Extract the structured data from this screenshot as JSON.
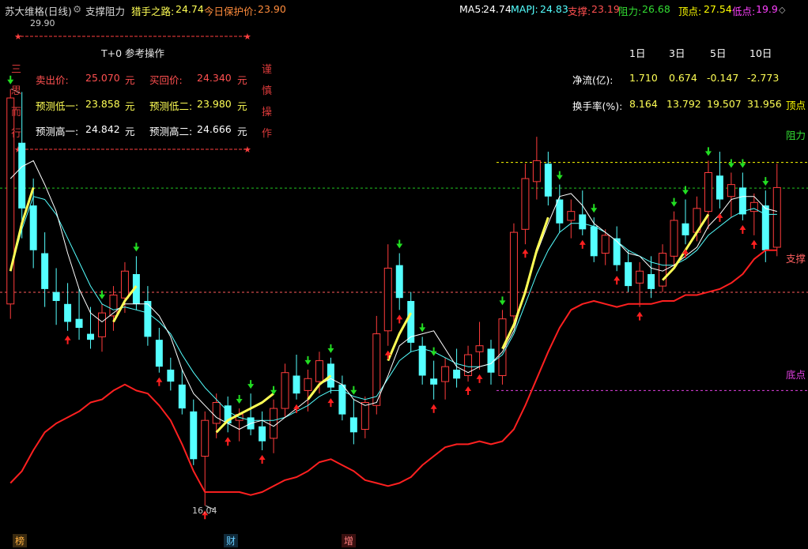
{
  "header": {
    "stock_name": "苏大维格(日线)",
    "indicator_name": "支撑阻力",
    "hunter_label": "猎手之路:",
    "hunter_value": "24.74",
    "protect_label": "今日保护价:",
    "protect_value": "23.90",
    "ma5_label": "MA5:",
    "ma5_value": "24.74",
    "mapj_label": "MAPJ:",
    "mapj_value": "24.83",
    "support_label": "支撑:",
    "support_value": "23.19",
    "resist_label": "阻力:",
    "resist_value": "26.68",
    "top_label": "顶点:",
    "top_value": "27.54",
    "bottom_label": "低点:",
    "bottom_value": "19.9"
  },
  "t0_panel": {
    "title": "T+0 参考操作",
    "left_vertical": [
      "三",
      "思",
      "而",
      "行"
    ],
    "right_vertical": [
      "谨",
      "慎",
      "操",
      "作"
    ],
    "rows": [
      {
        "l1": "卖出价:",
        "v1": "25.070",
        "u1": "元",
        "l2": "买回价:",
        "v2": "24.340",
        "u2": "元"
      },
      {
        "l1": "预测低一:",
        "v1": "23.858",
        "u1": "元",
        "l2": "预测低二:",
        "v2": "23.980",
        "u2": "元"
      },
      {
        "l1": "预测高一:",
        "v1": "24.842",
        "u1": "元",
        "l2": "预测高二:",
        "v2": "24.666",
        "u2": "元"
      }
    ]
  },
  "stats_table": {
    "periods": [
      "1日",
      "3日",
      "5日",
      "10日"
    ],
    "rows": [
      {
        "label": "净流(亿):",
        "values": [
          "1.710",
          "0.674",
          "-0.147",
          "-2.773"
        ]
      },
      {
        "label": "换手率(%):",
        "values": [
          "8.164",
          "13.792",
          "19.507",
          "31.956"
        ]
      }
    ]
  },
  "level_labels": {
    "resist": "阻力",
    "top": "顶点",
    "support": "支撑",
    "bottom": "底点"
  },
  "price_marks": {
    "high": "29.90",
    "low": "16.04"
  },
  "bottom_badges": [
    "榜",
    "财",
    "增"
  ],
  "colors": {
    "up": "#ff3c3c",
    "down": "#54ffff",
    "fast_line": "#ffff55",
    "support_line": "#ff2020",
    "resist_line": "#22c422",
    "top_line": "#ffff00",
    "support_dash": "#ff5a5a",
    "bottom_dash": "#e040e0"
  },
  "chart_data": {
    "type": "candlestick",
    "ylim": [
      15.2,
      32.4
    ],
    "levels": {
      "resist": 26.68,
      "top": 27.54,
      "support": 23.19,
      "bottom": 19.9
    },
    "candles": [
      {
        "o": 22.8,
        "h": 30.0,
        "l": 22.3,
        "c": 29.7
      },
      {
        "o": 28.2,
        "h": 29.9,
        "l": 25.0,
        "c": 26.0
      },
      {
        "o": 26.1,
        "h": 27.0,
        "l": 24.0,
        "c": 24.6
      },
      {
        "o": 24.5,
        "h": 25.2,
        "l": 22.7,
        "c": 23.3
      },
      {
        "o": 23.2,
        "h": 24.0,
        "l": 22.1,
        "c": 22.9
      },
      {
        "o": 22.8,
        "h": 23.5,
        "l": 21.9,
        "c": 22.2
      },
      {
        "o": 22.3,
        "h": 23.3,
        "l": 21.6,
        "c": 22.0
      },
      {
        "o": 21.8,
        "h": 22.7,
        "l": 21.3,
        "c": 21.6
      },
      {
        "o": 21.7,
        "h": 22.8,
        "l": 21.2,
        "c": 22.5
      },
      {
        "o": 22.4,
        "h": 23.4,
        "l": 21.9,
        "c": 23.1
      },
      {
        "o": 23.0,
        "h": 24.2,
        "l": 22.5,
        "c": 23.9
      },
      {
        "o": 23.8,
        "h": 24.4,
        "l": 22.6,
        "c": 22.8
      },
      {
        "o": 22.9,
        "h": 23.4,
        "l": 21.4,
        "c": 21.7
      },
      {
        "o": 21.6,
        "h": 22.0,
        "l": 20.5,
        "c": 20.7
      },
      {
        "o": 20.6,
        "h": 21.0,
        "l": 19.9,
        "c": 20.2
      },
      {
        "o": 20.1,
        "h": 20.6,
        "l": 19.1,
        "c": 19.3
      },
      {
        "o": 19.2,
        "h": 19.6,
        "l": 17.4,
        "c": 17.6
      },
      {
        "o": 17.7,
        "h": 19.2,
        "l": 16.04,
        "c": 18.9
      },
      {
        "o": 18.8,
        "h": 19.8,
        "l": 18.3,
        "c": 19.5
      },
      {
        "o": 19.4,
        "h": 19.7,
        "l": 18.5,
        "c": 18.8
      },
      {
        "o": 18.9,
        "h": 19.3,
        "l": 18.2,
        "c": 19.1
      },
      {
        "o": 19.0,
        "h": 19.8,
        "l": 18.4,
        "c": 18.6
      },
      {
        "o": 18.7,
        "h": 19.2,
        "l": 17.9,
        "c": 18.2
      },
      {
        "o": 18.3,
        "h": 19.6,
        "l": 17.8,
        "c": 19.3
      },
      {
        "o": 19.3,
        "h": 20.8,
        "l": 19.0,
        "c": 20.5
      },
      {
        "o": 20.4,
        "h": 21.1,
        "l": 19.6,
        "c": 19.8
      },
      {
        "o": 19.9,
        "h": 20.6,
        "l": 19.2,
        "c": 20.3
      },
      {
        "o": 20.2,
        "h": 21.2,
        "l": 19.8,
        "c": 20.9
      },
      {
        "o": 20.8,
        "h": 21.0,
        "l": 19.8,
        "c": 20.0
      },
      {
        "o": 20.1,
        "h": 20.4,
        "l": 18.9,
        "c": 19.1
      },
      {
        "o": 19.0,
        "h": 19.6,
        "l": 18.1,
        "c": 18.5
      },
      {
        "o": 18.6,
        "h": 19.7,
        "l": 18.3,
        "c": 19.5
      },
      {
        "o": 19.4,
        "h": 22.4,
        "l": 19.1,
        "c": 21.8
      },
      {
        "o": 21.9,
        "h": 24.8,
        "l": 21.4,
        "c": 24.0
      },
      {
        "o": 24.1,
        "h": 24.5,
        "l": 22.6,
        "c": 23.0
      },
      {
        "o": 22.9,
        "h": 23.2,
        "l": 21.2,
        "c": 21.5
      },
      {
        "o": 21.4,
        "h": 21.7,
        "l": 20.1,
        "c": 20.4
      },
      {
        "o": 20.3,
        "h": 20.9,
        "l": 19.6,
        "c": 20.1
      },
      {
        "o": 20.2,
        "h": 21.0,
        "l": 19.6,
        "c": 20.7
      },
      {
        "o": 20.6,
        "h": 21.3,
        "l": 20.0,
        "c": 20.3
      },
      {
        "o": 20.4,
        "h": 21.4,
        "l": 20.2,
        "c": 21.1
      },
      {
        "o": 21.2,
        "h": 22.2,
        "l": 20.6,
        "c": 21.4
      },
      {
        "o": 21.3,
        "h": 21.6,
        "l": 20.1,
        "c": 20.5
      },
      {
        "o": 20.4,
        "h": 22.6,
        "l": 20.1,
        "c": 22.3
      },
      {
        "o": 22.4,
        "h": 25.5,
        "l": 22.0,
        "c": 25.2
      },
      {
        "o": 25.3,
        "h": 27.5,
        "l": 24.8,
        "c": 27.0
      },
      {
        "o": 26.9,
        "h": 28.4,
        "l": 26.3,
        "c": 27.6
      },
      {
        "o": 27.5,
        "h": 27.9,
        "l": 26.1,
        "c": 26.4
      },
      {
        "o": 26.3,
        "h": 26.8,
        "l": 25.2,
        "c": 25.5
      },
      {
        "o": 25.6,
        "h": 26.3,
        "l": 25.0,
        "c": 25.9
      },
      {
        "o": 25.8,
        "h": 26.6,
        "l": 25.1,
        "c": 25.3
      },
      {
        "o": 25.4,
        "h": 25.7,
        "l": 24.2,
        "c": 24.4
      },
      {
        "o": 24.5,
        "h": 25.3,
        "l": 24.1,
        "c": 25.1
      },
      {
        "o": 25.0,
        "h": 25.4,
        "l": 23.9,
        "c": 24.1
      },
      {
        "o": 24.2,
        "h": 24.6,
        "l": 23.2,
        "c": 23.4
      },
      {
        "o": 23.5,
        "h": 24.2,
        "l": 22.7,
        "c": 23.9
      },
      {
        "o": 23.8,
        "h": 24.4,
        "l": 23.0,
        "c": 23.3
      },
      {
        "o": 23.4,
        "h": 24.8,
        "l": 23.2,
        "c": 24.5
      },
      {
        "o": 24.4,
        "h": 25.9,
        "l": 24.0,
        "c": 25.6
      },
      {
        "o": 25.5,
        "h": 26.3,
        "l": 24.8,
        "c": 25.1
      },
      {
        "o": 25.2,
        "h": 26.4,
        "l": 24.9,
        "c": 26.0
      },
      {
        "o": 25.9,
        "h": 27.6,
        "l": 25.3,
        "c": 27.2
      },
      {
        "o": 27.1,
        "h": 27.9,
        "l": 26.0,
        "c": 26.3
      },
      {
        "o": 26.4,
        "h": 27.2,
        "l": 25.7,
        "c": 26.8
      },
      {
        "o": 26.7,
        "h": 27.2,
        "l": 25.6,
        "c": 25.8
      },
      {
        "o": 25.9,
        "h": 26.5,
        "l": 25.1,
        "c": 26.2
      },
      {
        "o": 26.1,
        "h": 26.6,
        "l": 24.2,
        "c": 24.6
      },
      {
        "o": 24.7,
        "h": 27.5,
        "l": 24.4,
        "c": 26.7
      }
    ],
    "ma5": [
      27.0,
      27.4,
      27.6,
      26.8,
      25.9,
      24.5,
      23.3,
      22.5,
      22.2,
      22.5,
      22.8,
      22.8,
      22.8,
      22.4,
      21.7,
      20.6,
      19.8,
      19.4,
      19.0,
      18.8,
      18.6,
      18.8,
      18.9,
      18.7,
      19.0,
      19.3,
      19.6,
      20.1,
      20.3,
      20.1,
      19.6,
      19.4,
      19.5,
      20.4,
      21.4,
      21.7,
      21.8,
      21.9,
      21.3,
      20.7,
      20.5,
      20.7,
      20.8,
      21.2,
      21.9,
      23.3,
      24.5,
      25.5,
      26.4,
      26.5,
      26.1,
      25.5,
      25.2,
      24.9,
      24.5,
      24.4,
      24.0,
      23.9,
      24.1,
      24.4,
      24.7,
      25.4,
      25.8,
      26.3,
      26.4,
      26.4,
      26.0,
      25.9
    ],
    "mapj": [
      23.9,
      25.3,
      26.4,
      26.3,
      25.8,
      25.0,
      24.2,
      23.4,
      22.8,
      22.6,
      22.7,
      22.6,
      22.5,
      22.2,
      21.8,
      21.1,
      20.5,
      20.0,
      19.6,
      19.2,
      19.0,
      18.9,
      18.9,
      18.9,
      19.0,
      19.2,
      19.4,
      19.7,
      19.9,
      19.9,
      19.7,
      19.6,
      19.7,
      20.3,
      20.9,
      21.2,
      21.3,
      21.2,
      21.0,
      20.8,
      20.7,
      20.7,
      20.8,
      21.1,
      21.8,
      22.8,
      23.8,
      24.6,
      25.2,
      25.5,
      25.5,
      25.4,
      25.2,
      24.9,
      24.6,
      24.4,
      24.2,
      24.1,
      24.1,
      24.3,
      24.6,
      25.1,
      25.4,
      25.7,
      25.9,
      26.0,
      25.8,
      25.8
    ],
    "hunter": [
      23.9,
      25.5,
      26.7,
      null,
      null,
      null,
      null,
      null,
      null,
      22.2,
      22.9,
      23.4,
      null,
      null,
      null,
      null,
      null,
      null,
      18.5,
      18.9,
      19.1,
      19.3,
      19.5,
      19.8,
      null,
      null,
      19.6,
      20.1,
      20.4,
      null,
      null,
      null,
      null,
      20.9,
      21.8,
      22.5,
      null,
      null,
      null,
      null,
      null,
      null,
      null,
      21.3,
      22.1,
      23.2,
      24.6,
      25.7,
      null,
      null,
      null,
      null,
      null,
      null,
      null,
      null,
      null,
      23.6,
      24.0,
      24.6,
      25.2,
      25.8,
      null,
      null,
      null,
      null,
      null,
      24.9
    ],
    "support": [
      16.8,
      17.2,
      17.9,
      18.5,
      18.8,
      19.0,
      19.2,
      19.5,
      19.6,
      19.9,
      20.1,
      19.9,
      19.8,
      19.4,
      18.9,
      18.1,
      17.2,
      16.5,
      16.5,
      16.5,
      16.5,
      16.4,
      16.5,
      16.7,
      16.9,
      17.0,
      17.2,
      17.5,
      17.6,
      17.4,
      17.2,
      16.9,
      16.8,
      16.7,
      16.8,
      17.0,
      17.4,
      17.7,
      18.0,
      18.1,
      18.1,
      18.2,
      18.1,
      18.2,
      18.6,
      19.4,
      20.3,
      21.2,
      22.0,
      22.6,
      22.8,
      22.9,
      22.8,
      22.7,
      22.8,
      22.8,
      22.8,
      22.9,
      22.9,
      23.1,
      23.1,
      23.2,
      23.3,
      23.5,
      23.8,
      24.3,
      24.6,
      24.6
    ],
    "up_arrows": [
      5,
      13,
      17,
      19,
      22,
      25,
      28,
      33,
      34,
      37,
      40,
      41,
      45,
      50,
      53,
      55,
      59,
      62,
      64,
      65
    ],
    "down_arrows": [
      0,
      8,
      11,
      20,
      21,
      23,
      26,
      28,
      30,
      34,
      36,
      37,
      43,
      48,
      51,
      58,
      59,
      61,
      63,
      64,
      66
    ]
  }
}
